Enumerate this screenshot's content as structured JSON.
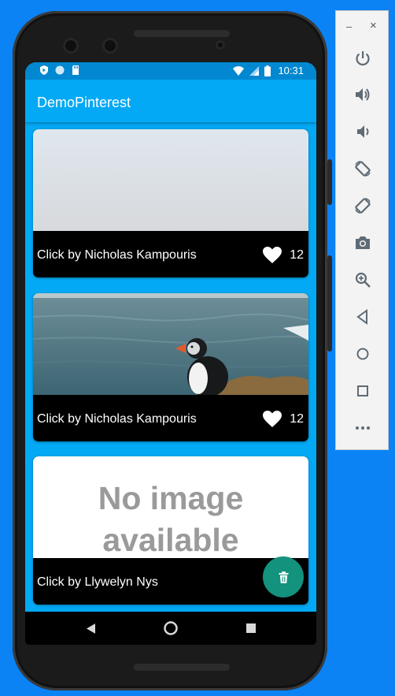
{
  "window": {
    "minimize_glyph": "–",
    "close_glyph": "×"
  },
  "status_bar": {
    "time": "10:31",
    "left_icons": [
      "shield-icon",
      "circle-icon",
      "sd-card-icon"
    ],
    "right_icons": [
      "wifi-icon",
      "signal-icon",
      "battery-icon"
    ]
  },
  "app_bar": {
    "title": "DemoPinterest",
    "color": "#03a9f4"
  },
  "feed": {
    "items": [
      {
        "caption": "Click by Nicholas Kampouris",
        "likes": "12",
        "image": "foggy-sky"
      },
      {
        "caption": "Click by Nicholas Kampouris",
        "likes": "12",
        "image": "puffin-sea"
      },
      {
        "caption": "Click by Llywelyn Nys",
        "likes": "",
        "image": "no-image-placeholder",
        "placeholder_line1": "No image",
        "placeholder_line2": "available"
      }
    ]
  },
  "fab": {
    "icon": "trash-icon",
    "color": "#13927e"
  },
  "nav_bar": {
    "buttons": [
      "back-icon",
      "home-icon",
      "recents-icon"
    ]
  },
  "emulator_toolbar": {
    "tools": [
      "power-icon",
      "volume-up-icon",
      "volume-down-icon",
      "rotate-left-icon",
      "rotate-right-icon",
      "camera-icon",
      "zoom-icon",
      "back-icon",
      "home-icon",
      "overview-icon",
      "more-icon"
    ]
  }
}
